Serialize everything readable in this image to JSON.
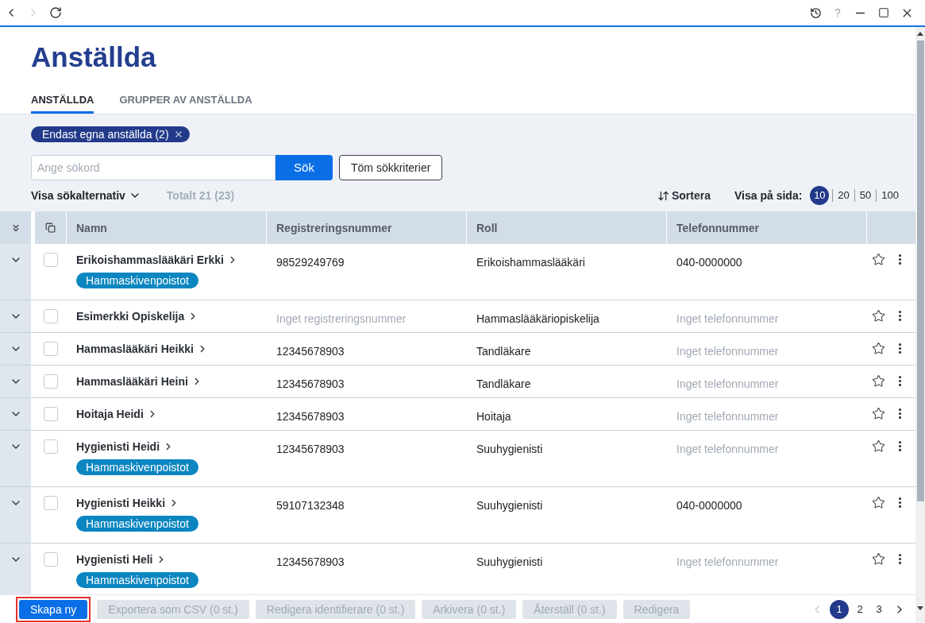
{
  "window_bar": {
    "nav_buttons": [
      {
        "kind": "back",
        "disabled": false
      },
      {
        "kind": "forward",
        "disabled": true
      },
      {
        "kind": "reload",
        "disabled": false
      }
    ],
    "tool_buttons": [
      {
        "kind": "history",
        "disabled": false
      },
      {
        "kind": "help",
        "label": "?",
        "disabled": true
      },
      {
        "kind": "minimize",
        "disabled": false
      },
      {
        "kind": "maximize",
        "disabled": false
      },
      {
        "kind": "close",
        "disabled": false
      }
    ]
  },
  "page": {
    "title": "Anställda"
  },
  "tabs": [
    {
      "label": "ANSTÄLLDA",
      "selected": true
    },
    {
      "label": "GRUPPER AV ANSTÄLLDA",
      "selected": false
    }
  ],
  "filter_chips": [
    {
      "label": "Endast egna anställda (2)"
    }
  ],
  "search": {
    "placeholder": "Ange sökord",
    "button": "Sök"
  },
  "clear_button": "Töm sökkriterier",
  "search_options": {
    "label": "Visa sökalternativ",
    "expanded": false
  },
  "total": "Totalt 21 (23)",
  "sort": {
    "label": "Sortera"
  },
  "page_size": {
    "label": "Visa på sida:",
    "options": [
      {
        "label": "10",
        "selected": true
      },
      {
        "label": "20",
        "selected": false
      },
      {
        "label": "50",
        "selected": false
      },
      {
        "label": "100",
        "selected": false
      }
    ]
  },
  "table": {
    "columns": [
      "Namn",
      "Registreringsnummer",
      "Roll",
      "Telefonnummer"
    ],
    "rows": [
      {
        "name": "Erikoishammaslääkäri Erkki",
        "registration": {
          "text": "98529249769",
          "empty": false
        },
        "role": "Erikoishammaslääkäri",
        "phone": {
          "text": "040-0000000",
          "empty": false
        },
        "tags": [
          "Hammaskivenpoistot"
        ],
        "checked": false,
        "expanded": false,
        "favorite": false
      },
      {
        "name": "Esimerkki Opiskelija",
        "registration": {
          "text": "Inget registreringsnummer",
          "empty": true
        },
        "role": "Hammaslääkäriopiskelija",
        "phone": {
          "text": "Inget telefonnummer",
          "empty": true
        },
        "checked": false,
        "expanded": false,
        "favorite": false
      },
      {
        "name": "Hammaslääkäri Heikki",
        "registration": {
          "text": "12345678903",
          "empty": false
        },
        "role": "Tandläkare",
        "phone": {
          "text": "Inget telefonnummer",
          "empty": true
        },
        "checked": false,
        "expanded": false,
        "favorite": false
      },
      {
        "name": "Hammaslääkäri Heini",
        "registration": {
          "text": "12345678903",
          "empty": false
        },
        "role": "Tandläkare",
        "phone": {
          "text": "Inget telefonnummer",
          "empty": true
        },
        "checked": false,
        "expanded": false,
        "favorite": false
      },
      {
        "name": "Hoitaja Heidi",
        "registration": {
          "text": "12345678903",
          "empty": false
        },
        "role": "Hoitaja",
        "phone": {
          "text": "Inget telefonnummer",
          "empty": true
        },
        "checked": false,
        "expanded": false,
        "favorite": false
      },
      {
        "name": "Hygienisti Heidi",
        "registration": {
          "text": "12345678903",
          "empty": false
        },
        "role": "Suuhygienisti",
        "phone": {
          "text": "Inget telefonnummer",
          "empty": true
        },
        "tags": [
          "Hammaskivenpoistot"
        ],
        "checked": false,
        "expanded": false,
        "favorite": false
      },
      {
        "name": "Hygienisti Heikki",
        "registration": {
          "text": "59107132348",
          "empty": false
        },
        "role": "Suuhygienisti",
        "phone": {
          "text": "040-0000000",
          "empty": false
        },
        "tags": [
          "Hammaskivenpoistot"
        ],
        "checked": false,
        "expanded": false,
        "favorite": false
      },
      {
        "name": "Hygienisti Heli",
        "registration": {
          "text": "12345678903",
          "empty": false
        },
        "role": "Suuhygienisti",
        "phone": {
          "text": "Inget telefonnummer",
          "empty": true
        },
        "tags": [
          "Hammaskivenpoistot"
        ],
        "checked": false,
        "expanded": false,
        "favorite": false
      }
    ]
  },
  "actions": [
    {
      "label": "Skapa ny",
      "disabled": false,
      "highlighted": true
    },
    {
      "label": "Exportera som CSV (0 st.)",
      "disabled": true,
      "highlighted": false
    },
    {
      "label": "Redigera identifierare (0 st.)",
      "disabled": true,
      "highlighted": false
    },
    {
      "label": "Arkivera (0 st.)",
      "disabled": true,
      "highlighted": false
    },
    {
      "label": "Återställ (0 st.)",
      "disabled": true,
      "highlighted": false
    },
    {
      "label": "Redigera",
      "disabled": true,
      "highlighted": false
    }
  ],
  "pagination": {
    "prev_disabled": true,
    "next_disabled": false,
    "pages": [
      {
        "label": "1",
        "selected": true
      },
      {
        "label": "2",
        "selected": false
      },
      {
        "label": "3",
        "selected": false
      }
    ]
  }
}
